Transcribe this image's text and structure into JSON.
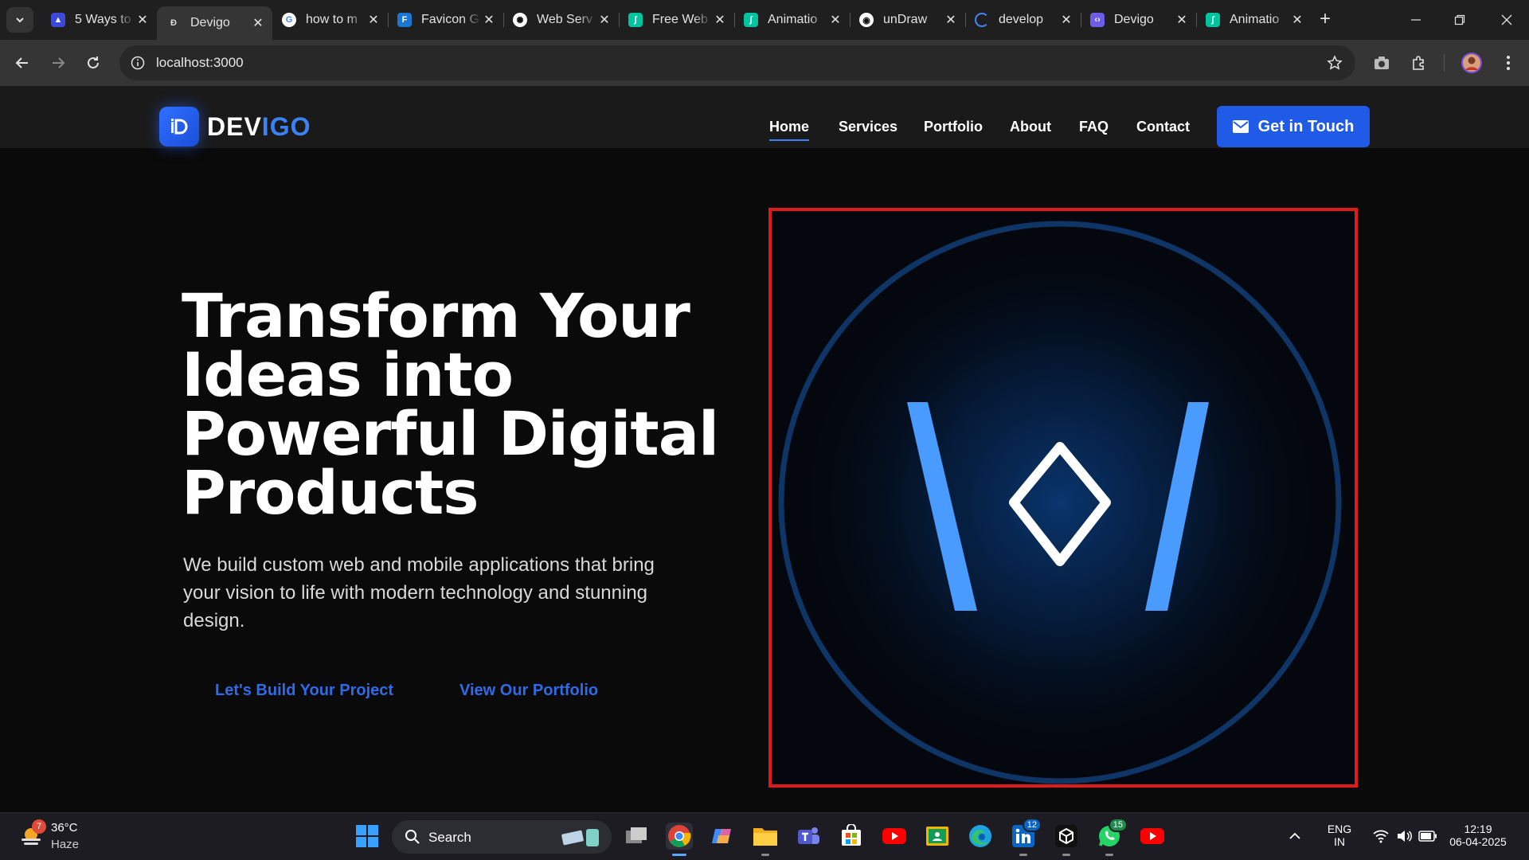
{
  "browser": {
    "tabs": [
      {
        "title": "5 Ways to",
        "icon": "site-icon",
        "color": "#3b4bd8",
        "active": false
      },
      {
        "title": "Devigo",
        "icon": "devigo-icon",
        "color": "#ffffff",
        "active": true
      },
      {
        "title": "how to m",
        "icon": "google-icon",
        "color": "#ffffff",
        "active": false
      },
      {
        "title": "Favicon G",
        "icon": "favicon-generator-icon",
        "color": "#1976d2",
        "active": false
      },
      {
        "title": "Web Serv",
        "icon": "openai-icon",
        "color": "#ffffff",
        "active": false
      },
      {
        "title": "Free Web",
        "icon": "lottie-icon",
        "color": "#00c4a0",
        "active": false
      },
      {
        "title": "Animatio",
        "icon": "lottie-icon",
        "color": "#00c4a0",
        "active": false
      },
      {
        "title": "unDraw",
        "icon": "undraw-icon",
        "color": "#ffffff",
        "active": false
      },
      {
        "title": "develop",
        "icon": "loading-icon",
        "color": "#4285f4",
        "active": false
      },
      {
        "title": "Devigo",
        "icon": "devigo-purple-icon",
        "color": "#6c5ce7",
        "active": false
      },
      {
        "title": "Animatio",
        "icon": "lottie-icon",
        "color": "#00c4a0",
        "active": false
      }
    ],
    "url": "localhost:3000"
  },
  "site": {
    "brand": {
      "part1": "DEV",
      "part2": "IGO",
      "accent": "#3b82f6"
    },
    "nav": [
      "Home",
      "Services",
      "Portfolio",
      "About",
      "FAQ",
      "Contact"
    ],
    "active_nav": "Home",
    "cta_label": "Get in Touch",
    "hero": {
      "title": "Transform Your Ideas into Powerful Digital Products",
      "subtitle": "We build custom web and mobile applications that bring your vision to life with modern technology and stunning design.",
      "primary_button": "Let's Build Your Project",
      "secondary_button": "View Our Portfolio"
    },
    "illustration": {
      "icon": "devigo-code-mark-icon",
      "border_color": "#e01a1a",
      "mark_color": "#4a9bff"
    }
  },
  "taskbar": {
    "weather": {
      "temp": "36°C",
      "condition": "Haze",
      "alert_count": "7"
    },
    "search_label": "Search",
    "apps": [
      {
        "name": "task-view",
        "badge": ""
      },
      {
        "name": "chrome",
        "badge": ""
      },
      {
        "name": "copilot",
        "badge": ""
      },
      {
        "name": "file-explorer",
        "badge": ""
      },
      {
        "name": "teams",
        "badge": ""
      },
      {
        "name": "microsoft-store",
        "badge": ""
      },
      {
        "name": "youtube",
        "badge": ""
      },
      {
        "name": "google-classroom",
        "badge": ""
      },
      {
        "name": "edge",
        "badge": ""
      },
      {
        "name": "linkedin",
        "badge": "12"
      },
      {
        "name": "cube-app",
        "badge": ""
      },
      {
        "name": "whatsapp",
        "badge": "15"
      },
      {
        "name": "youtube-music",
        "badge": ""
      }
    ],
    "tray": {
      "lang1": "ENG",
      "lang2": "IN",
      "time": "12:19",
      "date": "06-04-2025"
    }
  }
}
